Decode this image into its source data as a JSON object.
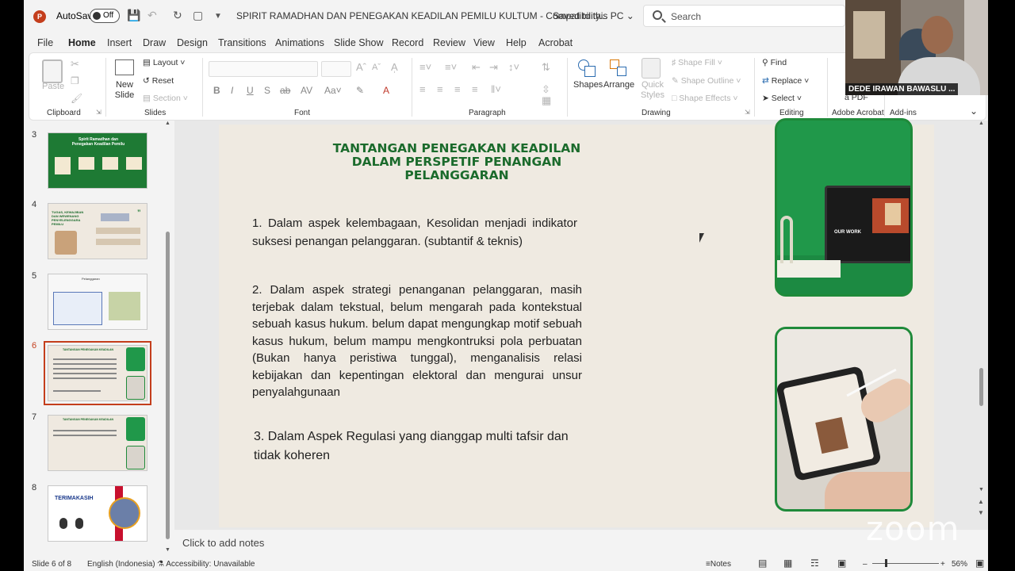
{
  "titlebar": {
    "autosave_label": "AutoSave",
    "autosave_state": "Off",
    "doc_title": "SPIRIT RAMADHAN DAN PENEGAKAN KEADILAN PEMILU KULTUM  -  Compatibility...",
    "saved_status": "Saved to this PC",
    "search_placeholder": "Search"
  },
  "tabs": [
    "File",
    "Home",
    "Insert",
    "Draw",
    "Design",
    "Transitions",
    "Animations",
    "Slide Show",
    "Record",
    "Review",
    "View",
    "Help",
    "Acrobat"
  ],
  "active_tab": "Home",
  "ribbon": {
    "clipboard": {
      "paste": "Paste",
      "label": "Clipboard"
    },
    "slides": {
      "new_slide": "New Slide",
      "layout": "Layout",
      "reset": "Reset",
      "section": "Section",
      "label": "Slides"
    },
    "font": {
      "label": "Font"
    },
    "paragraph": {
      "label": "Paragraph"
    },
    "drawing": {
      "shapes": "Shapes",
      "arrange": "Arrange",
      "quick_styles": "Quick Styles",
      "shape_fill": "Shape Fill",
      "shape_outline": "Shape Outline",
      "shape_effects": "Shape Effects",
      "label": "Drawing"
    },
    "editing": {
      "find": "Find",
      "replace": "Replace",
      "select": "Select",
      "label": "Editing"
    },
    "acrobat": {
      "label": "Adobe Acrobat",
      "partial": "a PDF"
    },
    "addins": {
      "label": "Add-ins"
    }
  },
  "thumbnails": [
    {
      "number": "3",
      "title": "Spirit Ramadhan dan Penegakan Keadilan Pemilu"
    },
    {
      "number": "4",
      "title": "TUGAS, KEWAJIBAN DAN WEWENANG PENYELENGGARA PEMILU"
    },
    {
      "number": "5",
      "title": "Pelanggaran"
    },
    {
      "number": "6",
      "title": "TANTANGAN PENEGAKAN KEADILAN"
    },
    {
      "number": "7",
      "title": "TANTANGAN PENEGAKAN KEADILAN"
    },
    {
      "number": "8",
      "title": "TERIMAKASIH"
    }
  ],
  "slide": {
    "title_lines": [
      "TANTANGAN PENEGAKAN KEADILAN",
      "DALAM PERSPETIF PENANGAN",
      "PELANGGARAN"
    ],
    "point1": "1. Dalam aspek kelembagaan, Kesolidan menjadi indikator suksesi penangan pelanggaran. (subtantif & teknis)",
    "point2": "2. Dalam aspek strategi penanganan pelanggaran, masih terjebak dalam tekstual, belum mengarah pada kontekstual sebuah kasus hukum. belum dapat mengungkap motif sebuah kasus hukum, belum mampu mengkontruksi pola perbuatan (Bukan hanya peristiwa tunggal), menganalisis relasi kebijakan dan kepentingan elektoral dan mengurai unsur penyalahgunaan",
    "point3": "3. Dalam Aspek Regulasi yang dianggap multi tafsir dan tidak koheren",
    "laptop_text": "OUR WORK"
  },
  "notes_placeholder": "Click to add notes",
  "statusbar": {
    "slide_count": "Slide 6 of 8",
    "language": "English (Indonesia)",
    "accessibility": "Accessibility: Unavailable",
    "notes": "Notes",
    "zoom": "56%"
  },
  "webcam": {
    "name": "DEDE IRAWAN BAWASLU ..."
  },
  "watermark": "zoom",
  "colors": {
    "accent": "#c43e1c",
    "slide_green": "#1b6b2c",
    "photo_border": "#1f8a3a"
  }
}
